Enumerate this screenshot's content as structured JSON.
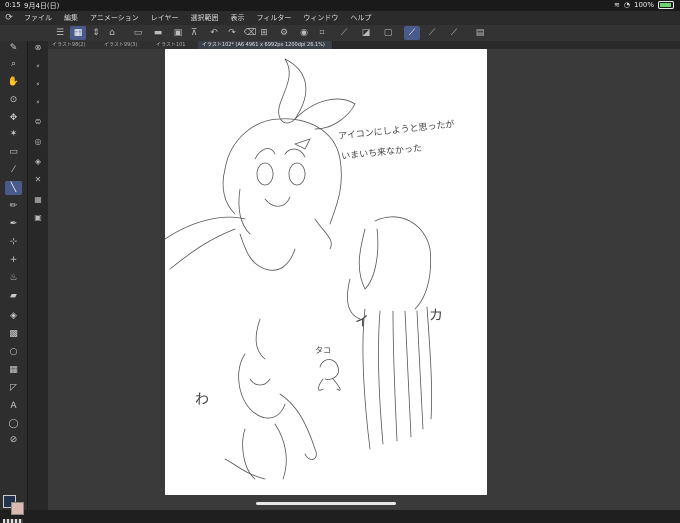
{
  "status": {
    "time": "0:15",
    "date": "9月4日(日)",
    "battery": "100%"
  },
  "menu": {
    "items": [
      "ファイル",
      "編集",
      "アニメーション",
      "レイヤー",
      "選択範囲",
      "表示",
      "フィルター",
      "ウィンドウ",
      "ヘルプ"
    ]
  },
  "tabs": [
    {
      "label": "イラスト98(2)"
    },
    {
      "label": "イラスト99(3)"
    },
    {
      "label": "イラスト101"
    },
    {
      "label": "イラスト102* (A6 4961 x 6992px 1200dpi 26.1%)"
    }
  ],
  "canvas": {
    "note_line1": "アイコンにしようと思ったが",
    "note_line2": "いまいち来なかった",
    "label_i": "イ",
    "label_ka": "カ",
    "label_wa": "わ",
    "label_tako": "タコ"
  },
  "colors": {
    "accent": "#4a5a8a",
    "foreground": "#223349",
    "background": "#d9b9b0"
  }
}
